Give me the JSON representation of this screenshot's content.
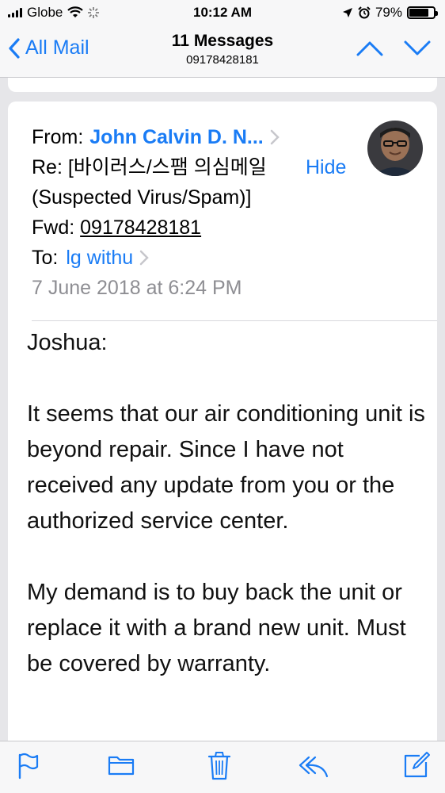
{
  "status_bar": {
    "carrier": "Globe",
    "time": "10:12 AM",
    "battery": "79%",
    "battery_level": 0.79
  },
  "nav": {
    "back_label": "All Mail",
    "title": "11 Messages",
    "subtitle": "09178428181"
  },
  "message": {
    "from_label": "From:",
    "from_name": "John Calvin D. N...",
    "subject_line1": "Re: [바이러스/스팸 의심메일",
    "subject_line2": "(Suspected Virus/Spam)]",
    "hide_label": "Hide",
    "fwd_label": "Fwd:",
    "fwd_number": "09178428181",
    "to_label": "To:",
    "to_name": "lg withu",
    "date": "7 June 2018 at 6:24 PM",
    "body": [
      "Joshua:",
      "It seems that our air conditioning unit is beyond repair. Since I have not received any update from you or the authorized service center.",
      "My demand is to buy back the unit or replace it with a brand new unit. Must be covered by warranty."
    ]
  },
  "colors": {
    "accent": "#1a7cf5",
    "muted": "#8e8e93",
    "background": "#e6e6e9"
  },
  "icons": [
    "signal-icon",
    "wifi-icon",
    "activity-icon",
    "location-icon",
    "alarm-icon",
    "battery-icon",
    "back-chevron-icon",
    "chevron-up-icon",
    "chevron-down-icon",
    "flag-icon",
    "folder-icon",
    "trash-icon",
    "reply-icon",
    "compose-icon"
  ]
}
